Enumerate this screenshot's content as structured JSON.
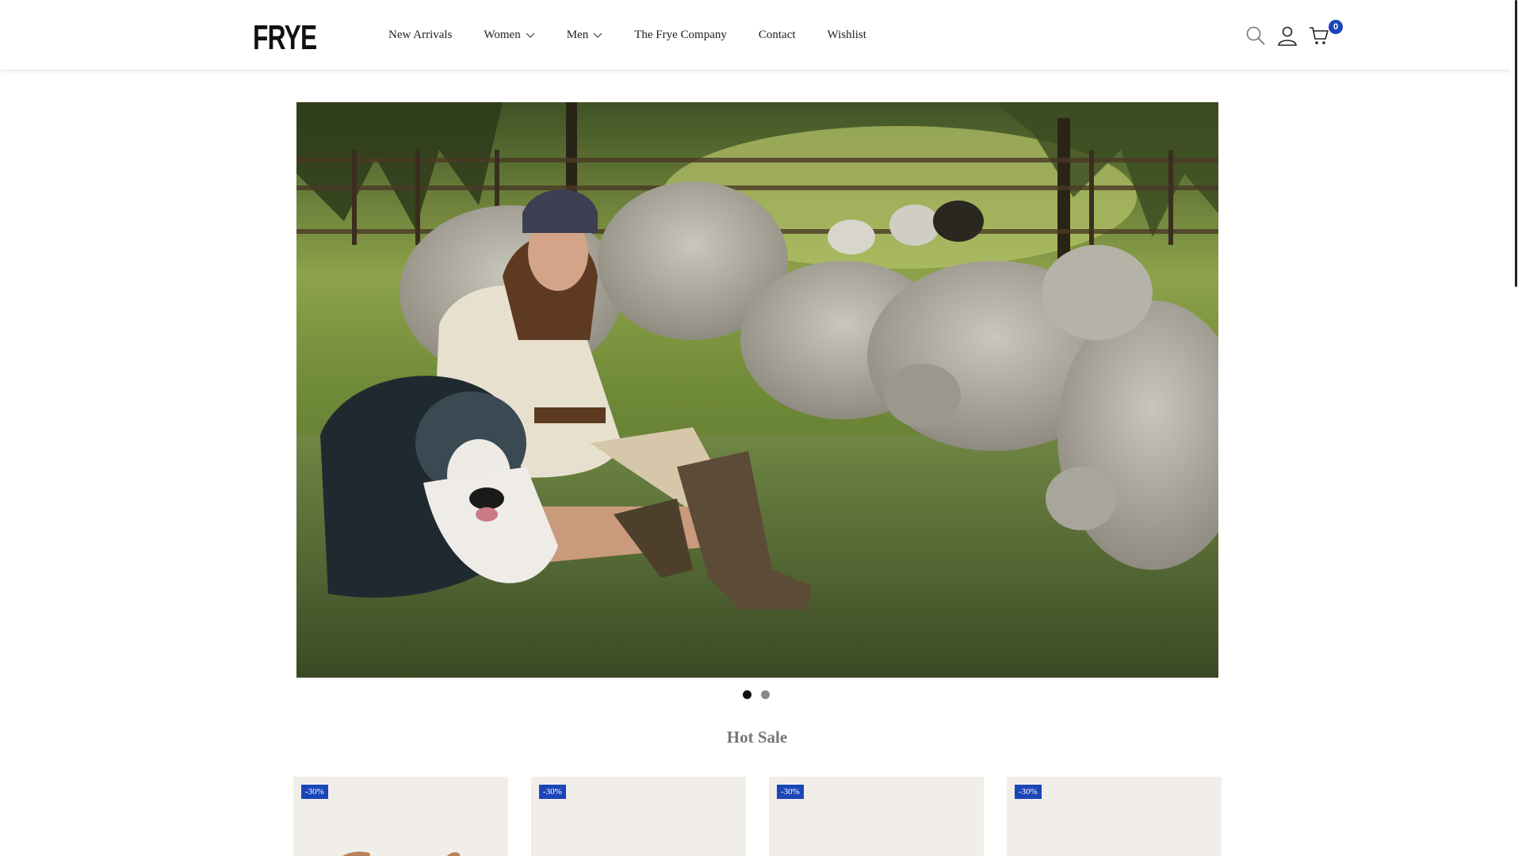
{
  "brand": {
    "logo_text": "FRYE"
  },
  "nav": {
    "items": [
      {
        "label": "New Arrivals"
      },
      {
        "label": "Women"
      },
      {
        "label": "Men"
      },
      {
        "label": "The Frye Company"
      },
      {
        "label": "Contact"
      },
      {
        "label": "Wishlist"
      }
    ]
  },
  "header_icons": {
    "search": "search-icon",
    "account": "user-icon",
    "cart": "cart-icon",
    "cart_count": "0"
  },
  "hero": {
    "slides": 2,
    "active_slide": 1
  },
  "section": {
    "title": "Hot Sale"
  },
  "products": [
    {
      "badge": "-30%"
    },
    {
      "badge": "-30%"
    },
    {
      "badge": "-30%"
    },
    {
      "badge": "-30%"
    }
  ],
  "colors": {
    "accent": "#1a46b8",
    "text": "#222222",
    "card_bg": "#f1eeea"
  }
}
